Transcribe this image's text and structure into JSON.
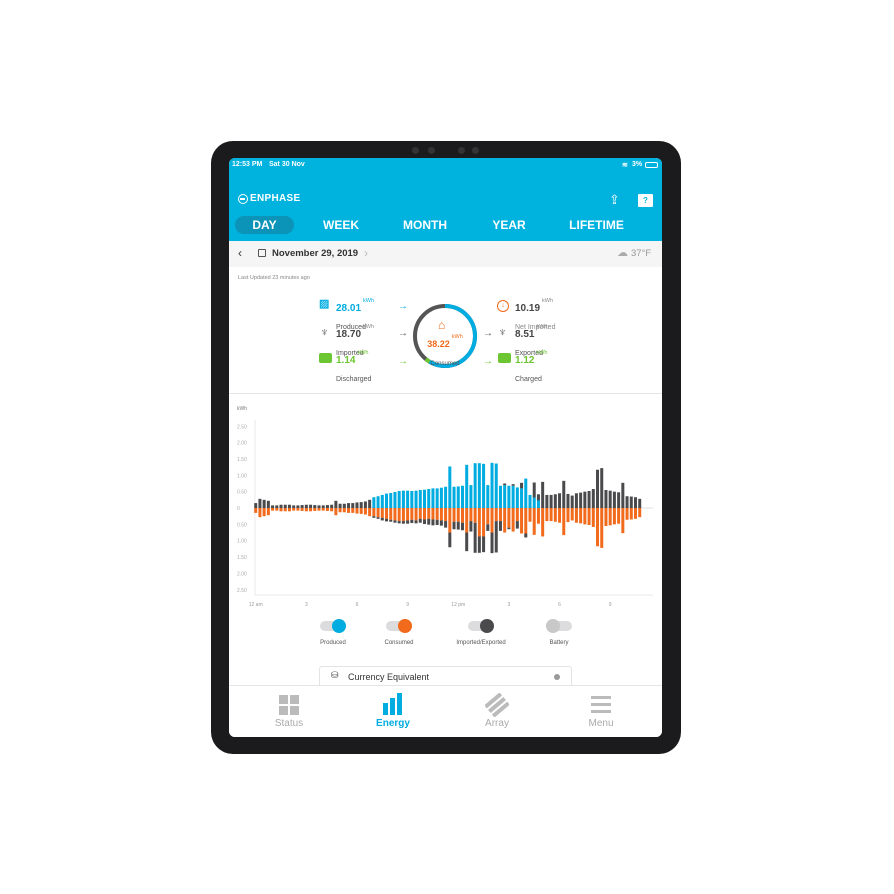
{
  "status_bar": {
    "time": "12:53 PM",
    "date": "Sat 30 Nov",
    "battery": "3%"
  },
  "header": {
    "brand": "ENPHASE",
    "tabs": [
      "DAY",
      "WEEK",
      "MONTH",
      "YEAR",
      "LIFETIME"
    ],
    "active_tab": "DAY"
  },
  "date_bar": {
    "date": "November 29, 2019",
    "weather": "37°F"
  },
  "last_updated": "Last Updated 23 minutes ago",
  "summary": {
    "produced": {
      "value": "28.01",
      "unit": "kWh",
      "label": "Produced"
    },
    "imported": {
      "value": "18.70",
      "unit": "kWh",
      "label": "Imported"
    },
    "discharged": {
      "value": "1.14",
      "unit": "kWh",
      "label": "Discharged"
    },
    "consumed": {
      "value": "38.22",
      "unit": "kWh",
      "label": "Consumed"
    },
    "net_imported": {
      "value": "10.19",
      "unit": "kWh",
      "label": "Net Imported"
    },
    "exported": {
      "value": "8.51",
      "unit": "kWh",
      "label": "Exported"
    },
    "charged": {
      "value": "1.12",
      "unit": "kWh",
      "label": "Charged"
    }
  },
  "colors": {
    "brand": "#00b2de",
    "produced": "#00ace0",
    "consumed": "#f26a1b",
    "grid": "#4a4a4d",
    "battery": "#6cc631"
  },
  "chart_data": {
    "type": "bar",
    "ylabel": "kWh",
    "ylim": [
      -2.5,
      2.5
    ],
    "y_ticks": [
      "2.50",
      "2.00",
      "1.50",
      "1.00",
      "0.50",
      "0",
      "0.50",
      "1.00",
      "1.50",
      "2.00",
      "2.50"
    ],
    "x_ticks": [
      "12 am",
      "3",
      "6",
      "9",
      "12 pm",
      "3",
      "6",
      "9"
    ],
    "interval": "15 min",
    "series": {
      "produced": [
        0,
        0,
        0,
        0,
        0,
        0,
        0,
        0,
        0,
        0,
        0,
        0,
        0,
        0,
        0,
        0,
        0,
        0,
        0,
        0,
        0,
        0,
        0,
        0,
        0,
        0,
        0,
        0,
        0.33,
        0.36,
        0.4,
        0.44,
        0.46,
        0.49,
        0.52,
        0.53,
        0.53,
        0.52,
        0.53,
        0.55,
        0.56,
        0.58,
        0.6,
        0.6,
        0.62,
        0.65,
        1.27,
        0.65,
        0.66,
        0.68,
        1.32,
        0.7,
        1.37,
        1.37,
        1.35,
        0.7,
        1.38,
        1.36,
        0.68,
        0.7,
        0.68,
        0.68,
        0.63,
        0.6,
        0.9,
        0.4,
        0.32,
        0.23,
        0,
        0,
        0,
        0,
        0,
        0,
        0,
        0,
        0,
        0,
        0,
        0,
        0,
        0,
        0,
        0,
        0,
        0,
        0,
        0,
        0,
        0,
        0,
        0
      ],
      "imported": [
        0.15,
        0.28,
        0.25,
        0.22,
        0.08,
        0.08,
        0.1,
        0.1,
        0.1,
        0.08,
        0.08,
        0.09,
        0.1,
        0.1,
        0.09,
        0.08,
        0.08,
        0.09,
        0.1,
        0.22,
        0.13,
        0.13,
        0.15,
        0.15,
        0.17,
        0.18,
        0.2,
        0.25,
        0,
        0,
        0,
        0,
        0,
        0,
        0,
        0,
        0,
        0,
        0,
        0,
        0,
        0,
        0,
        0,
        0,
        0,
        0,
        0,
        0,
        0,
        0,
        0,
        0,
        0,
        0,
        0,
        0,
        0,
        0,
        0.05,
        0,
        0.05,
        0,
        0.17,
        0,
        0,
        0.46,
        0.19,
        0.8,
        0.4,
        0.4,
        0.42,
        0.45,
        0.83,
        0.43,
        0.38,
        0.45,
        0.47,
        0.5,
        0.52,
        0.58,
        1.17,
        1.22,
        0.55,
        0.53,
        0.5,
        0.48,
        0.77,
        0.36,
        0.35,
        0.33,
        0.28
      ],
      "consumed": [
        0.15,
        0.28,
        0.25,
        0.22,
        0.08,
        0.08,
        0.1,
        0.1,
        0.1,
        0.08,
        0.08,
        0.09,
        0.1,
        0.1,
        0.09,
        0.08,
        0.08,
        0.09,
        0.1,
        0.22,
        0.13,
        0.13,
        0.15,
        0.15,
        0.17,
        0.18,
        0.2,
        0.25,
        0.25,
        0.28,
        0.3,
        0.33,
        0.36,
        0.38,
        0.4,
        0.4,
        0.38,
        0.36,
        0.38,
        0.33,
        0.35,
        0.33,
        0.35,
        0.36,
        0.38,
        0.4,
        0.75,
        0.42,
        0.42,
        0.45,
        0.75,
        0.4,
        0.45,
        0.87,
        0.87,
        0.5,
        0.75,
        0.4,
        0.4,
        0.75,
        0.6,
        0.72,
        0.4,
        0.78,
        0.78,
        0.42,
        0.82,
        0.48,
        0.87,
        0.4,
        0.4,
        0.42,
        0.45,
        0.83,
        0.43,
        0.38,
        0.45,
        0.47,
        0.5,
        0.52,
        0.58,
        1.17,
        1.22,
        0.55,
        0.53,
        0.5,
        0.48,
        0.77,
        0.36,
        0.35,
        0.33,
        0.28
      ],
      "exported": [
        0,
        0,
        0,
        0,
        0,
        0,
        0,
        0,
        0,
        0,
        0,
        0,
        0,
        0,
        0,
        0,
        0,
        0,
        0,
        0,
        0,
        0,
        0,
        0,
        0,
        0,
        0,
        0,
        0.05,
        0.05,
        0.08,
        0.08,
        0.06,
        0.07,
        0.07,
        0.08,
        0.1,
        0.1,
        0.09,
        0.12,
        0.14,
        0.18,
        0.18,
        0.16,
        0.16,
        0.2,
        0.45,
        0.23,
        0.24,
        0.23,
        0.57,
        0.32,
        0.92,
        0.5,
        0.48,
        0.2,
        0.63,
        0.96,
        0.3,
        0,
        0.05,
        0,
        0.23,
        0,
        0.12,
        0,
        0,
        0,
        0,
        0,
        0,
        0,
        0,
        0,
        0,
        0,
        0,
        0,
        0,
        0,
        0,
        0,
        0,
        0,
        0,
        0,
        0,
        0,
        0,
        0,
        0,
        0
      ]
    }
  },
  "legend": [
    {
      "label": "Produced",
      "on": true
    },
    {
      "label": "Consumed",
      "on": true
    },
    {
      "label": "Imported/Exported",
      "on": true
    },
    {
      "label": "Battery",
      "on": false
    }
  ],
  "currency": {
    "label": "Currency Equivalent"
  },
  "nav": [
    "Status",
    "Energy",
    "Array",
    "Menu"
  ],
  "nav_active": "Energy"
}
